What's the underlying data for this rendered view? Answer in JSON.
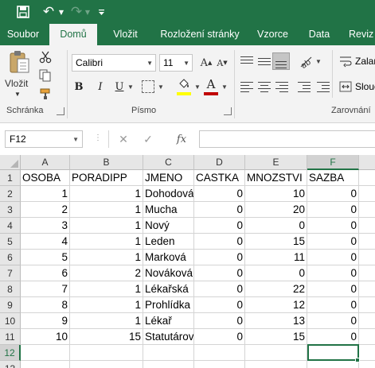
{
  "quick_access": {
    "save_icon": "save-icon",
    "undo_icon": "undo-icon",
    "redo_icon": "redo-icon",
    "customize_icon": "customize-dropdown-icon"
  },
  "tabs": {
    "file": "Soubor",
    "home": "Domů",
    "insert": "Vložit",
    "page_layout": "Rozložení stránky",
    "formulas": "Vzorce",
    "data": "Data",
    "review": "Reviz"
  },
  "ribbon": {
    "clipboard": {
      "paste_label": "Vložit",
      "group_label": "Schránka"
    },
    "font": {
      "font_name": "Calibri",
      "font_size": "11",
      "grow_glyph": "A",
      "shrink_glyph": "A",
      "bold": "B",
      "italic": "I",
      "underline": "U",
      "font_color_glyph": "A",
      "group_label": "Písmo"
    },
    "alignment": {
      "wrap_label": "Zalam",
      "merge_label": "Slouč",
      "group_label": "Zarovnání"
    }
  },
  "formula_bar": {
    "name_box": "F12",
    "fx": "fx",
    "content": ""
  },
  "colors": {
    "accent": "#217346",
    "fill_color": "#ffff00",
    "font_color": "#c00000"
  },
  "sheet": {
    "columns": [
      "A",
      "B",
      "C",
      "D",
      "E",
      "F"
    ],
    "row_numbers": [
      "1",
      "2",
      "3",
      "4",
      "5",
      "6",
      "7",
      "8",
      "9",
      "10",
      "11",
      "12",
      "13"
    ],
    "selected_cell": "F12",
    "headers": [
      "OSOBA",
      "PORADIPP",
      "JMENO",
      "CASTKA",
      "MNOZSTVI",
      "SAZBA"
    ],
    "rows": [
      [
        "1",
        "1",
        "Dohodová",
        "0",
        "10",
        "0"
      ],
      [
        "2",
        "1",
        "Mucha",
        "0",
        "20",
        "0"
      ],
      [
        "3",
        "1",
        "Nový",
        "0",
        "0",
        "0"
      ],
      [
        "4",
        "1",
        "Leden",
        "0",
        "15",
        "0"
      ],
      [
        "5",
        "1",
        "Marková",
        "0",
        "11",
        "0"
      ],
      [
        "6",
        "2",
        "Nováková",
        "0",
        "0",
        "0"
      ],
      [
        "7",
        "1",
        "Lékařská",
        "0",
        "22",
        "0"
      ],
      [
        "8",
        "1",
        "Prohlídka",
        "0",
        "12",
        "0"
      ],
      [
        "9",
        "1",
        "Lékař",
        "0",
        "13",
        "0"
      ],
      [
        "10",
        "15",
        "Statutárov",
        "0",
        "15",
        "0"
      ]
    ]
  }
}
